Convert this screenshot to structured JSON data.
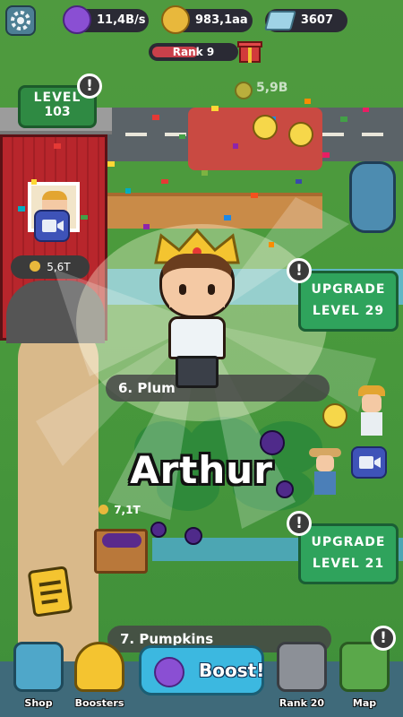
{
  "hud": {
    "sleep_income": "11,4B/s",
    "coins": "983,1aa",
    "diamonds": "3607",
    "rank_label": "Rank 9",
    "rank_progress": 0.55
  },
  "barn": {
    "level_title": "LEVEL",
    "level_value": "103",
    "price": "5,6T"
  },
  "warehouse": {
    "income": "5,9B"
  },
  "upgrades": [
    {
      "line1": "UPGRADE",
      "line2": "LEVEL 29"
    },
    {
      "line1": "UPGRADE",
      "line2": "LEVEL 21"
    }
  ],
  "fields": [
    {
      "label": "6. Plum",
      "price": "7,1T"
    },
    {
      "label": "7. Pumpkins"
    }
  ],
  "character": {
    "name": "Arthur"
  },
  "nav": {
    "shop": "Shop",
    "boosters": "Boosters",
    "boost": "Boost!",
    "rank": "Rank 20",
    "map": "Map"
  },
  "colors": {
    "grass": "#4a9a3c",
    "upgrade_green": "#2fa35c",
    "boost_blue": "#3cb8e0",
    "rank_red": "#c9404a"
  }
}
